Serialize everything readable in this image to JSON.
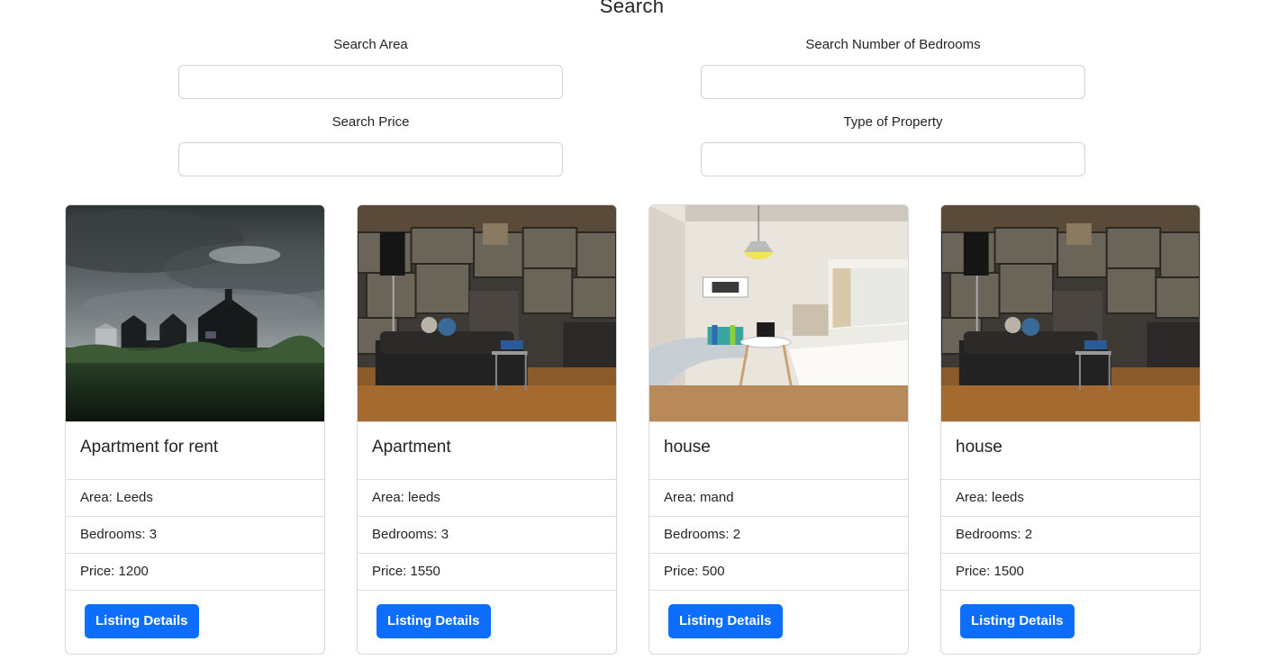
{
  "search": {
    "title": "Search",
    "area_label": "Search Area",
    "area_value": "",
    "bedrooms_label": "Search Number of Bedrooms",
    "bedrooms_value": "",
    "price_label": "Search Price",
    "price_value": "",
    "type_label": "Type of Property",
    "type_value": ""
  },
  "listings": [
    {
      "title": "Apartment for rent",
      "area": "Area: Leeds",
      "bedrooms": "Bedrooms: 3",
      "price": "Price: 1200",
      "button": "Listing Details"
    },
    {
      "title": "Apartment",
      "area": "Area: leeds",
      "bedrooms": "Bedrooms: 3",
      "price": "Price: 1550",
      "button": "Listing Details"
    },
    {
      "title": "house",
      "area": "Area: mand",
      "bedrooms": "Bedrooms: 2",
      "price": "Price: 500",
      "button": "Listing Details"
    },
    {
      "title": "house",
      "area": "Area: leeds",
      "bedrooms": "Bedrooms: 2",
      "price": "Price: 1500",
      "button": "Listing Details"
    }
  ],
  "colors": {
    "primary_button": "#0d6efd",
    "border": "#dedede"
  }
}
